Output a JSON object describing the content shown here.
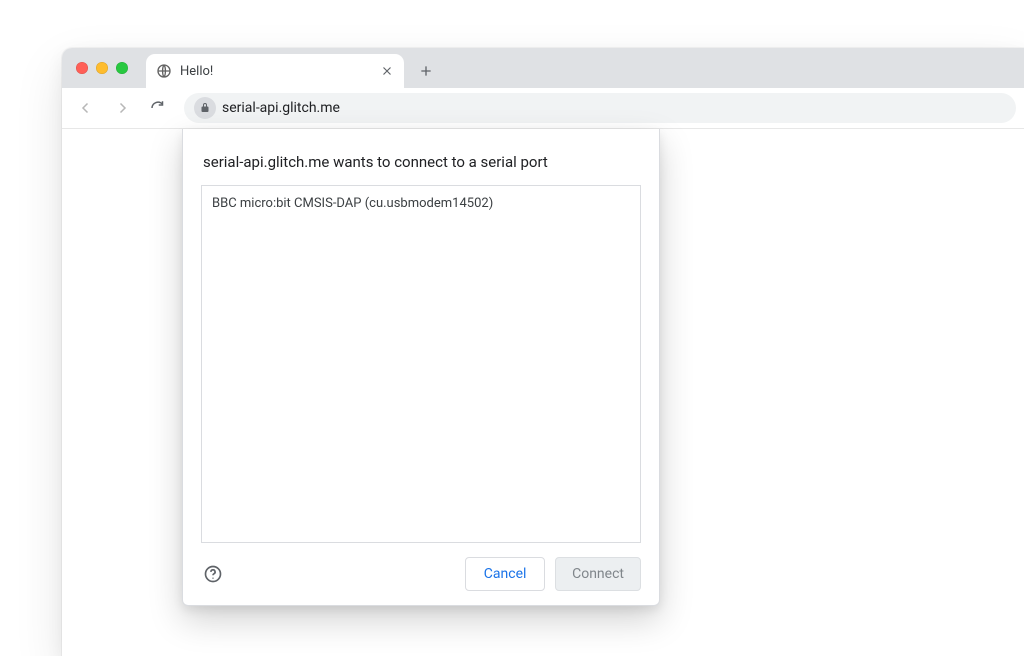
{
  "tab": {
    "title": "Hello!"
  },
  "toolbar": {
    "url": "serial-api.glitch.me"
  },
  "dialog": {
    "title": "serial-api.glitch.me wants to connect to a serial port",
    "items": [
      "BBC micro:bit CMSIS-DAP (cu.usbmodem14502)"
    ],
    "cancel_label": "Cancel",
    "connect_label": "Connect"
  }
}
